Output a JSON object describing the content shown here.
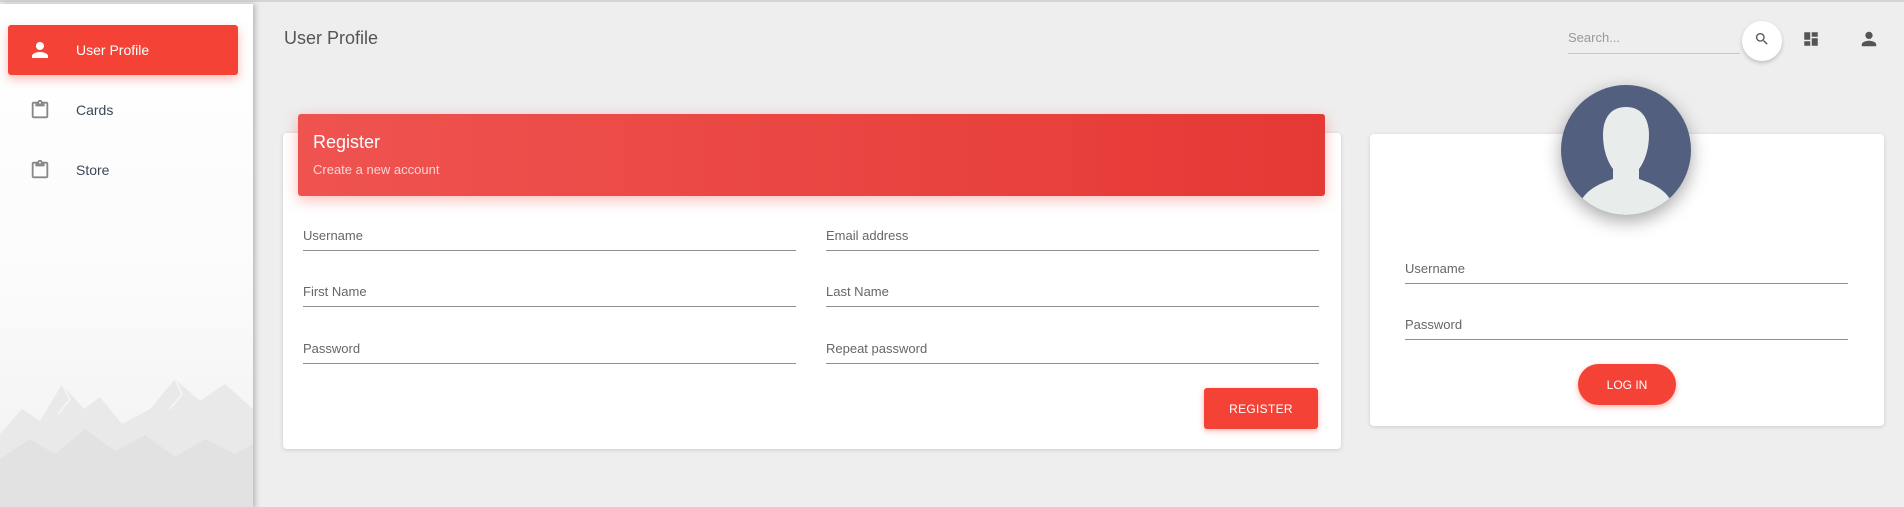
{
  "page": {
    "title": "User Profile"
  },
  "sidebar": {
    "items": [
      {
        "label": "User Profile",
        "icon": "person-icon",
        "active": true
      },
      {
        "label": "Cards",
        "icon": "clipboard-icon",
        "active": false
      },
      {
        "label": "Store",
        "icon": "clipboard-icon",
        "active": false
      }
    ]
  },
  "topbar": {
    "search_placeholder": "Search...",
    "icons": [
      "search-icon",
      "dashboard-icon",
      "person-icon"
    ]
  },
  "register": {
    "title": "Register",
    "subtitle": "Create a new account",
    "username_placeholder": "Username",
    "email_placeholder": "Email address",
    "first_name_placeholder": "First Name",
    "last_name_placeholder": "Last Name",
    "password_placeholder": "Password",
    "repeat_password_placeholder": "Repeat password",
    "button_label": "REGISTER"
  },
  "login": {
    "username_placeholder": "Username",
    "password_placeholder": "Password",
    "button_label": "LOG IN"
  },
  "colors": {
    "accent": "#f44336",
    "avatar_bg": "#525f7f",
    "background": "#eeeeee"
  }
}
